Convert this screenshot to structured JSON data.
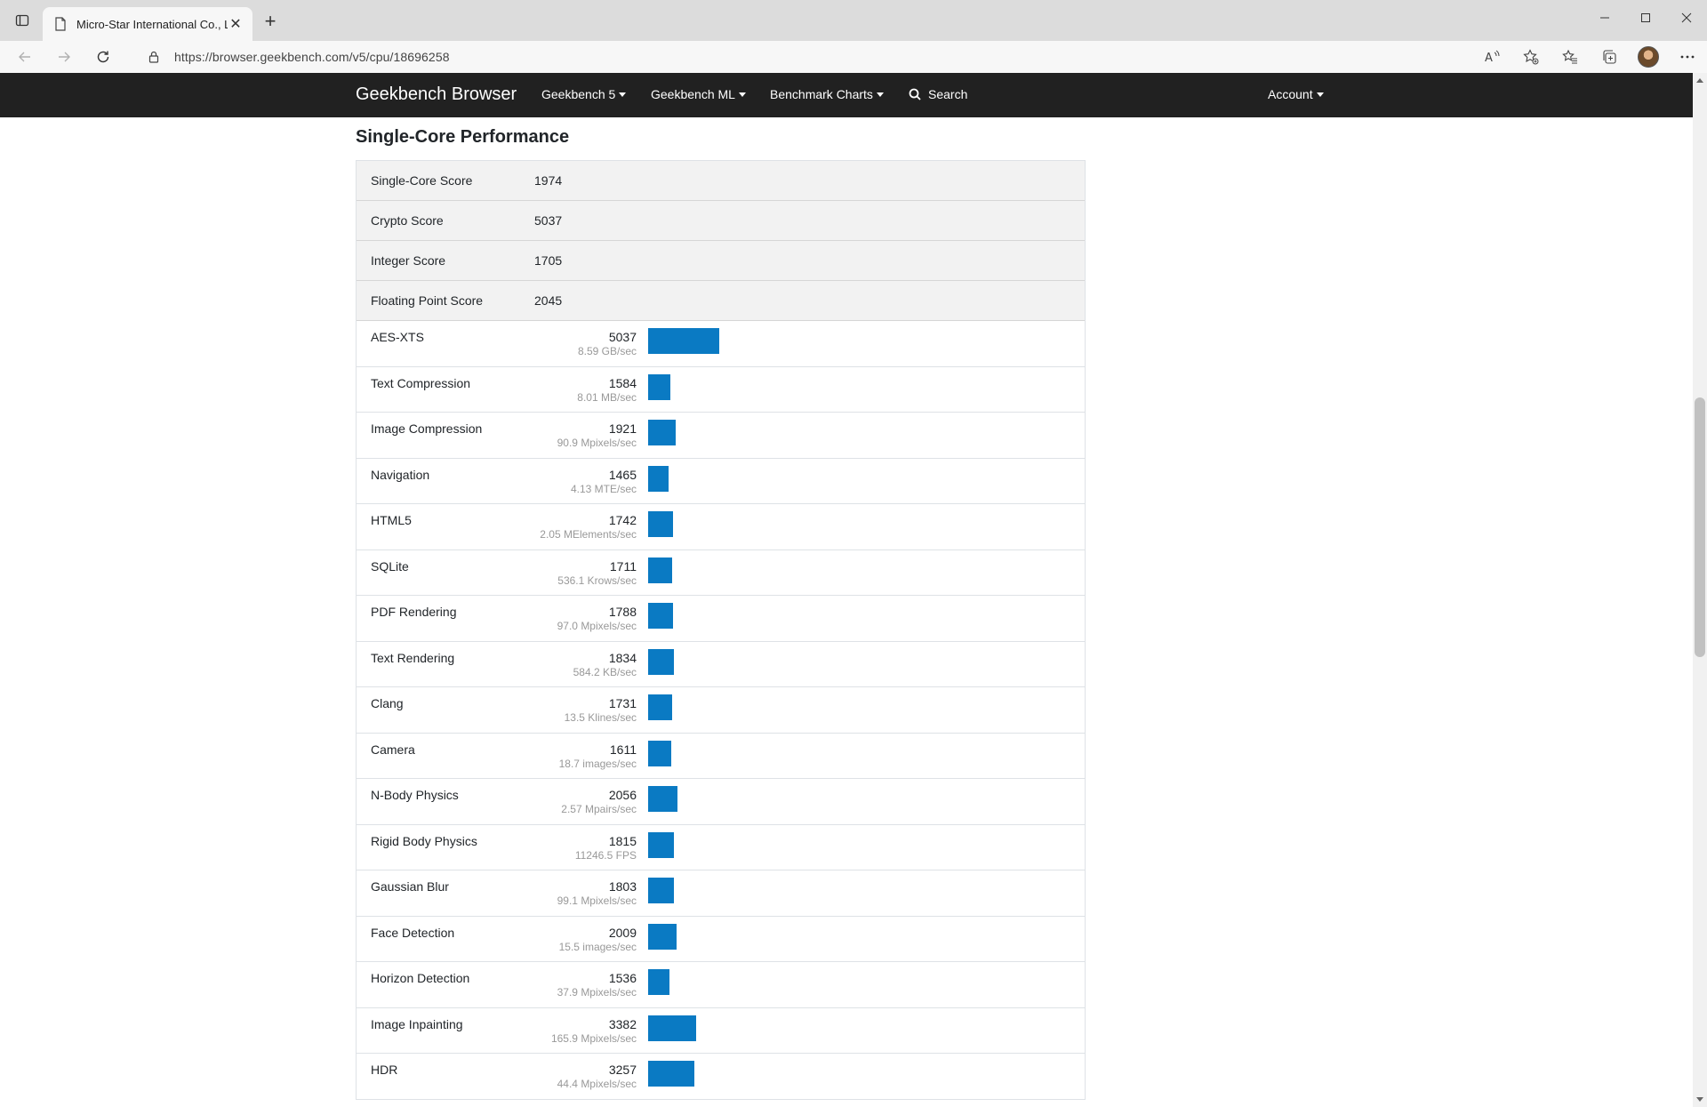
{
  "browser": {
    "tab_title": "Micro-Star International Co., Ltd",
    "url": "https://browser.geekbench.com/v5/cpu/18696258"
  },
  "navbar": {
    "brand": "Geekbench Browser",
    "items": [
      "Geekbench 5",
      "Geekbench ML",
      "Benchmark Charts"
    ],
    "search": "Search",
    "account": "Account"
  },
  "section": {
    "title": "Single-Core Performance"
  },
  "scores": [
    {
      "name": "Single-Core Score",
      "score": "1974"
    },
    {
      "name": "Crypto Score",
      "score": "5037"
    },
    {
      "name": "Integer Score",
      "score": "1705"
    },
    {
      "name": "Floating Point Score",
      "score": "2045"
    }
  ],
  "benchmarks": [
    {
      "name": "AES-XTS",
      "score": "5037",
      "desc": "8.59 GB/sec",
      "value": 5037
    },
    {
      "name": "Text Compression",
      "score": "1584",
      "desc": "8.01 MB/sec",
      "value": 1584
    },
    {
      "name": "Image Compression",
      "score": "1921",
      "desc": "90.9 Mpixels/sec",
      "value": 1921
    },
    {
      "name": "Navigation",
      "score": "1465",
      "desc": "4.13 MTE/sec",
      "value": 1465
    },
    {
      "name": "HTML5",
      "score": "1742",
      "desc": "2.05 MElements/sec",
      "value": 1742
    },
    {
      "name": "SQLite",
      "score": "1711",
      "desc": "536.1 Krows/sec",
      "value": 1711
    },
    {
      "name": "PDF Rendering",
      "score": "1788",
      "desc": "97.0 Mpixels/sec",
      "value": 1788
    },
    {
      "name": "Text Rendering",
      "score": "1834",
      "desc": "584.2 KB/sec",
      "value": 1834
    },
    {
      "name": "Clang",
      "score": "1731",
      "desc": "13.5 Klines/sec",
      "value": 1731
    },
    {
      "name": "Camera",
      "score": "1611",
      "desc": "18.7 images/sec",
      "value": 1611
    },
    {
      "name": "N-Body Physics",
      "score": "2056",
      "desc": "2.57 Mpairs/sec",
      "value": 2056
    },
    {
      "name": "Rigid Body Physics",
      "score": "1815",
      "desc": "11246.5 FPS",
      "value": 1815
    },
    {
      "name": "Gaussian Blur",
      "score": "1803",
      "desc": "99.1 Mpixels/sec",
      "value": 1803
    },
    {
      "name": "Face Detection",
      "score": "2009",
      "desc": "15.5 images/sec",
      "value": 2009
    },
    {
      "name": "Horizon Detection",
      "score": "1536",
      "desc": "37.9 Mpixels/sec",
      "value": 1536
    },
    {
      "name": "Image Inpainting",
      "score": "3382",
      "desc": "165.9 Mpixels/sec",
      "value": 3382
    },
    {
      "name": "HDR",
      "score": "3257",
      "desc": "44.4 Mpixels/sec",
      "value": 3257
    }
  ],
  "colors": {
    "bar": "#0a7ac3",
    "navbar": "#212121"
  }
}
